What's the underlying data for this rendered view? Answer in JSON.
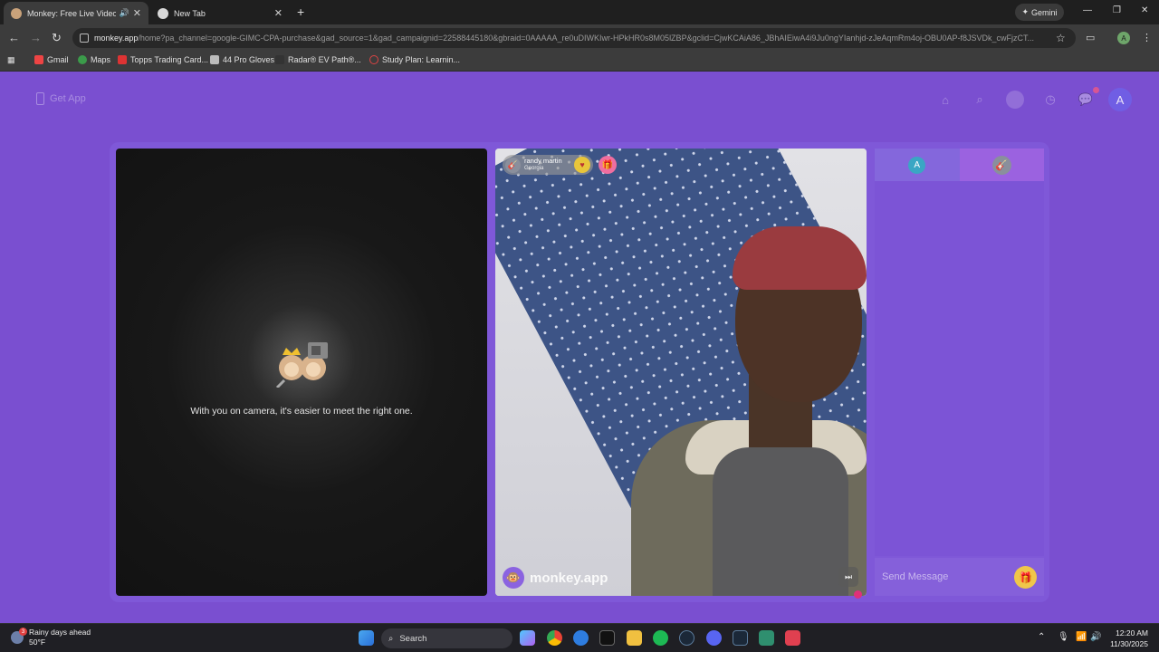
{
  "browser": {
    "tabs": [
      {
        "title": "Monkey: Free Live Video Ch",
        "active": true
      },
      {
        "title": "New Tab",
        "active": false
      }
    ],
    "gemini_label": "Gemini",
    "url_host": "monkey.app",
    "url_path": "/home?pa_channel=google-GIMC-CPA-purchase&gad_source=1&gad_campaignid=22588445180&gbraid=0AAAAA_re0uDIWKIwr-HPkHR0s8M05lZBP&gclid=CjwKCAiA86_JBhAIEiwA4i9Ju0ngYIanhjd-zJeAqmRm4oj-OBU0AP-f8JSVDk_cwFjzCT...",
    "profile_initial": "A",
    "bookmarks": [
      "Gmail",
      "Maps",
      "Topps Trading Card...",
      "44 Pro Gloves",
      "Radar® EV Path®...",
      "Study Plan: Learnin..."
    ]
  },
  "site": {
    "get_app_label": "Get App",
    "avatar_initial": "A",
    "self_prompt": "With you on camera, it's easier to meet the right one.",
    "peer": {
      "name": "randy martin",
      "location": "Georgia"
    },
    "watermark": "monkey.app",
    "chat": {
      "tab_initial": "A",
      "input_placeholder": "Send Message"
    }
  },
  "taskbar": {
    "weather_title": "Rainy days ahead",
    "weather_temp": "50°F",
    "weather_badge": "3",
    "search_label": "Search",
    "time": "12:20 AM",
    "date": "11/30/2025"
  },
  "colors": {
    "page_bg": "#7a4fd0",
    "panel_frame": "#7f58d8",
    "chat_tab_right": "#9b62e0",
    "gift_button": "#f0c64a"
  }
}
